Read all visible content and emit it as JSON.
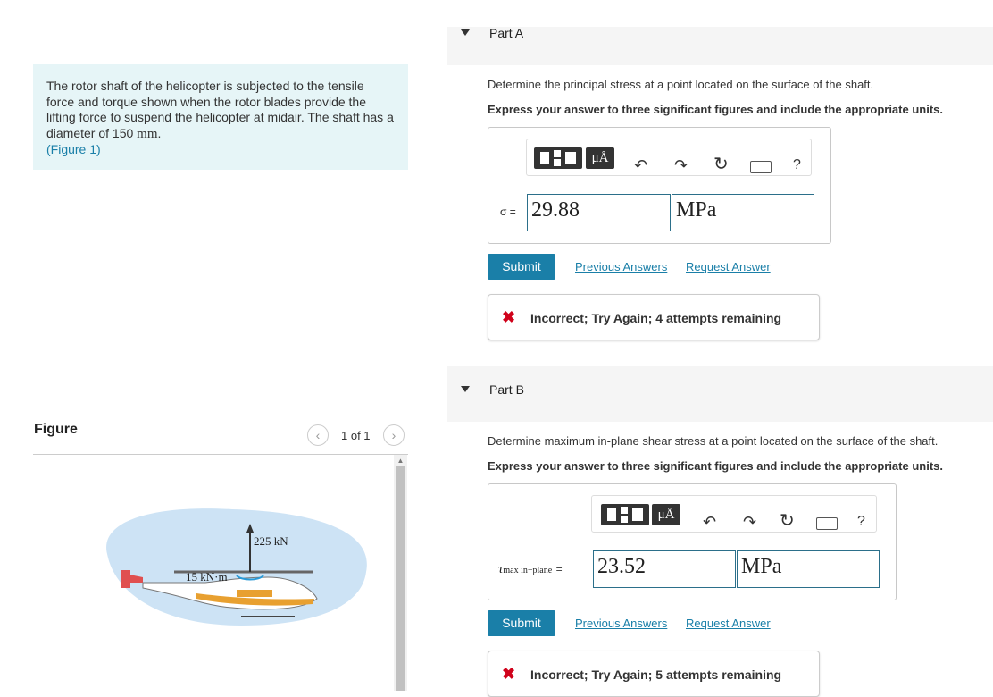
{
  "problem": {
    "text": "The rotor shaft of the helicopter is subjected to the tensile force and torque shown when the rotor blades provide the lifting force to suspend the helicopter at midair. The shaft has a diameter of 150 ",
    "unit": "mm",
    "period": ".",
    "figure_link": "(Figure 1)"
  },
  "figure": {
    "title": "Figure",
    "pager": "1 of 1",
    "force_label": "225 kN",
    "torque_label": "15 kN·m"
  },
  "parts": [
    {
      "title": "Part A",
      "question": "Determine the principal stress at a point located on the surface of the shaft.",
      "instruction": "Express your answer to three significant figures and include the appropriate units.",
      "variable": "σ =",
      "value": "29.88",
      "unit": "MPa",
      "submit": "Submit",
      "prev_answers": "Previous Answers",
      "request_answer": "Request Answer",
      "feedback": "Incorrect; Try Again; 4 attempts remaining"
    },
    {
      "title": "Part B",
      "question": "Determine maximum in-plane shear stress at a point located on the surface of the shaft.",
      "instruction": "Express your answer to three significant figures and include the appropriate units.",
      "variable_symbol": "τ",
      "variable_sub": "max in−plane",
      "variable_eq": "=",
      "value": "23.52",
      "unit": "MPa",
      "submit": "Submit",
      "prev_answers": "Previous Answers",
      "request_answer": "Request Answer",
      "feedback": "Incorrect; Try Again; 5 attempts remaining"
    }
  ],
  "toolbar": {
    "units_label": "μÅ",
    "help": "?",
    "icons": [
      "templates-icon",
      "units-icon",
      "undo-icon",
      "redo-icon",
      "reset-icon",
      "keyboard-icon",
      "help-icon"
    ]
  },
  "colors": {
    "accent": "#1a7fa8",
    "error": "#d0021b",
    "problem_bg": "#e6f5f7"
  }
}
